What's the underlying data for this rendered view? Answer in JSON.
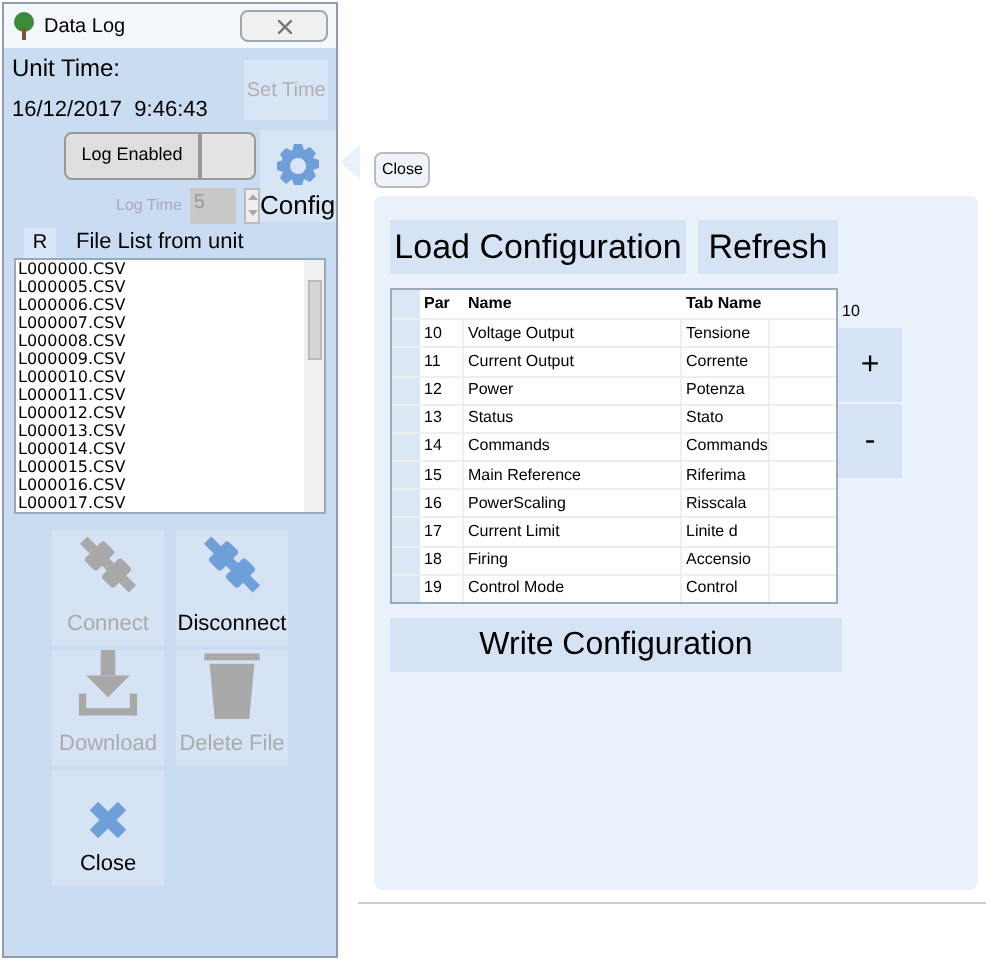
{
  "window": {
    "title": "Data Log"
  },
  "unit_time": {
    "label": "Unit Time:",
    "value": "16/12/2017  9:46:43"
  },
  "set_time": {
    "label": "Set Time",
    "disabled": true
  },
  "log_enabled": {
    "label": "Log Enabled",
    "on": false
  },
  "log_time": {
    "label": "Log Time",
    "value": "5",
    "disabled": true
  },
  "config": {
    "label": "Config"
  },
  "file_list": {
    "column_1": "R",
    "title": "File List from unit",
    "items": [
      "L000000.CSV",
      "L000005.CSV",
      "L000006.CSV",
      "L000007.CSV",
      "L000008.CSV",
      "L000009.CSV",
      "L000010.CSV",
      "L000011.CSV",
      "L000012.CSV",
      "L000013.CSV",
      "L000014.CSV",
      "L000015.CSV",
      "L000016.CSV",
      "L000017.CSV"
    ]
  },
  "actions": [
    {
      "kind": "connect",
      "label": "Connect",
      "disabled": true
    },
    {
      "kind": "disconnect",
      "label": "Disconnect",
      "disabled": false
    },
    {
      "kind": "download",
      "label": "Download",
      "disabled": true
    },
    {
      "kind": "delete",
      "label": "Delete File",
      "disabled": true
    },
    {
      "kind": "close",
      "label": "Close",
      "disabled": false
    }
  ],
  "config_panel": {
    "close": "Close",
    "load": "Load Configuration",
    "refresh": "Refresh",
    "counter": "10",
    "plus": "+",
    "minus": "-",
    "write": "Write Configuration",
    "table": {
      "columns": [
        "Par",
        "Name",
        "Tab Name"
      ],
      "rows": [
        [
          "10",
          "Voltage Output",
          "Tensione"
        ],
        [
          "11",
          "Current Output",
          "Corrente"
        ],
        [
          "12",
          "Power",
          "Potenza"
        ],
        [
          "13",
          "Status",
          "Stato"
        ],
        [
          "14",
          "Commands",
          "Commands"
        ],
        [
          "15",
          "Main Reference",
          "Riferima"
        ],
        [
          "16",
          "PowerScaling",
          "Risscala"
        ],
        [
          "17",
          "Current Limit",
          "Linite d"
        ],
        [
          "18",
          "Firing",
          "Accensio"
        ],
        [
          "19",
          "Control Mode",
          "Control"
        ]
      ]
    }
  }
}
